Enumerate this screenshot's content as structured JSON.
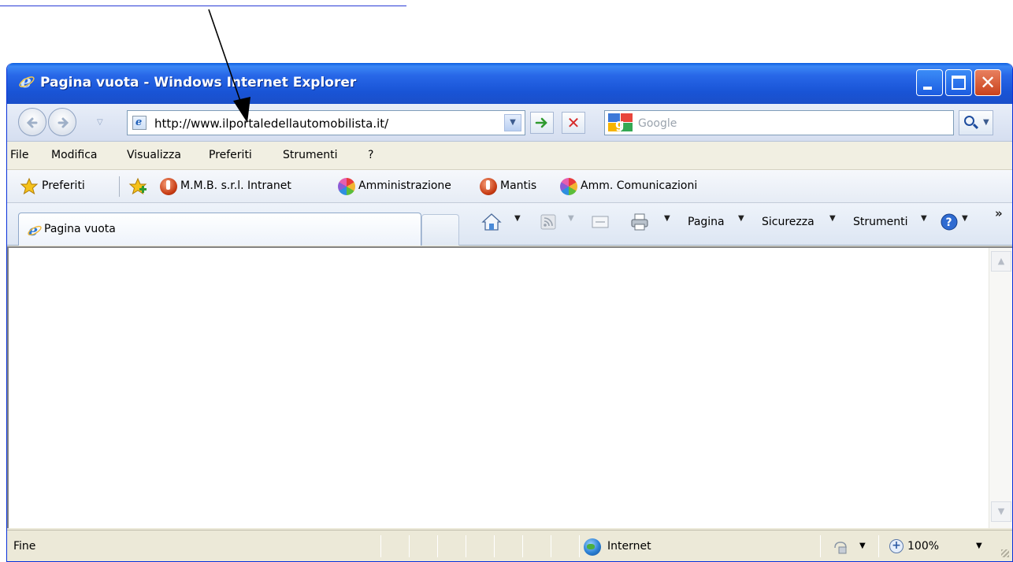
{
  "window": {
    "title": "Pagina vuota - Windows Internet Explorer"
  },
  "address": {
    "url": "http://www.ilportaledellautomobilista.it/"
  },
  "search": {
    "placeholder": "Google"
  },
  "menu": {
    "items": [
      "File",
      "Modifica",
      "Visualizza",
      "Preferiti",
      "Strumenti",
      "?"
    ]
  },
  "favorites": {
    "label": "Preferiti",
    "links": [
      "M.M.B. s.r.l. Intranet",
      "Amministrazione",
      "Mantis",
      "Amm. Comunicazioni"
    ]
  },
  "tabs": {
    "active_label": "Pagina vuota"
  },
  "commands": {
    "pagina": "Pagina",
    "sicurezza": "Sicurezza",
    "strumenti": "Strumenti"
  },
  "status": {
    "text": "Fine",
    "zone": "Internet",
    "zoom": "100%"
  },
  "colors": {
    "titlebar": "#1954d6",
    "chrome": "#ece9d8"
  },
  "icons": {
    "title": "ie-logo-icon",
    "back": "back-arrow-icon",
    "forward": "forward-arrow-icon",
    "go": "go-arrow-icon",
    "stop": "stop-x-icon",
    "search": "search-magnifier-icon",
    "home": "home-icon",
    "rss": "rss-feed-icon",
    "mail": "mail-icon",
    "print": "printer-icon",
    "help": "help-icon",
    "zone": "globe-icon",
    "zoom": "zoom-icon"
  }
}
